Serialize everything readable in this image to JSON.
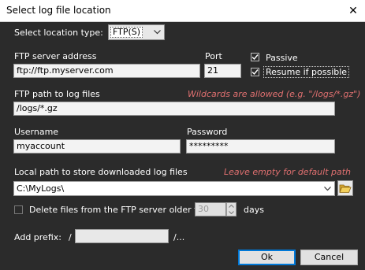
{
  "window": {
    "title": "Select log file location",
    "close_glyph": "✕"
  },
  "location": {
    "label": "Select location type:",
    "value": "FTP(S)"
  },
  "ftp": {
    "server_label": "FTP server address",
    "server_value": "ftp://ftp.myserver.com",
    "port_label": "Port",
    "port_value": "21",
    "passive_label": "Passive",
    "passive_checked": true,
    "resume_label": "Resume if possible",
    "resume_checked": true,
    "path_label": "FTP path to log files",
    "path_hint": "Wildcards are allowed (e.g. \"/logs/*.gz\")",
    "path_value": "/logs/*.gz",
    "username_label": "Username",
    "username_value": "myaccount",
    "password_label": "Password",
    "password_value": "*********"
  },
  "local": {
    "label": "Local path to store downloaded log files",
    "hint": "Leave empty for default path",
    "value": "C:\\MyLogs\\"
  },
  "delete": {
    "label": "Delete files from the FTP server older tha",
    "checked": false,
    "days_value": "30",
    "days_unit": "days"
  },
  "prefix": {
    "label": "Add prefix:",
    "slash": "/",
    "value": "",
    "suffix": "/..."
  },
  "buttons": {
    "ok": "Ok",
    "cancel": "Cancel"
  },
  "colors": {
    "background": "#2b2b2b",
    "hint": "#e07070",
    "accent": "#0078d7"
  }
}
